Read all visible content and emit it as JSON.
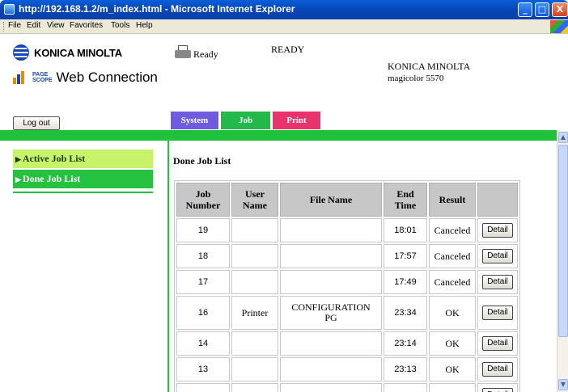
{
  "window": {
    "title": "http://192.168.1.2/m_index.html - Microsoft Internet Explorer",
    "min_glyph": "_",
    "max_glyph": "□",
    "close_glyph": "X"
  },
  "menu": [
    "File",
    "Edit",
    "View",
    "Favorites",
    "Tools",
    "Help"
  ],
  "header": {
    "brand_logo_text": "KONICA MINOLTA",
    "pagescope_small_top": "PAGE",
    "pagescope_small_bottom": "SCOPE",
    "pagescope_text": "Web Connection",
    "status_icon_label": "Ready",
    "status_text": "READY",
    "device_brand": "KONICA MINOLTA",
    "device_model": "magicolor 5570"
  },
  "logout_label": "Log out",
  "tabs": {
    "system": "System",
    "job": "Job",
    "print": "Print"
  },
  "sidebar": {
    "active_job_list": "Active Job List",
    "done_job_list": "Done Job List"
  },
  "main": {
    "section_title": "Done Job List"
  },
  "table": {
    "headers": {
      "job_number_1": "Job",
      "job_number_2": "Number",
      "user_name_1": "User",
      "user_name_2": "Name",
      "file_name": "File Name",
      "end_time_1": "End",
      "end_time_2": "Time",
      "result": "Result"
    },
    "detail_label": "Detail",
    "rows": [
      {
        "job": "19",
        "user": "",
        "file1": "",
        "file2": "",
        "time": "18:01",
        "result": "Canceled"
      },
      {
        "job": "18",
        "user": "",
        "file1": "",
        "file2": "",
        "time": "17:57",
        "result": "Canceled"
      },
      {
        "job": "17",
        "user": "",
        "file1": "",
        "file2": "",
        "time": "17:49",
        "result": "Canceled"
      },
      {
        "job": "16",
        "user": "Printer",
        "file1": "CONFIGURATION",
        "file2": "PG",
        "time": "23:34",
        "result": "OK"
      },
      {
        "job": "14",
        "user": "",
        "file1": "",
        "file2": "",
        "time": "23:14",
        "result": "OK"
      },
      {
        "job": "13",
        "user": "",
        "file1": "",
        "file2": "",
        "time": "23:13",
        "result": "OK"
      }
    ]
  },
  "colors": {
    "tab_system": "#6f5be0",
    "tab_job": "#22b94a",
    "tab_print": "#e8336c",
    "accent_green": "#21c13b",
    "sidebar_active_bg": "#c6f36a"
  }
}
